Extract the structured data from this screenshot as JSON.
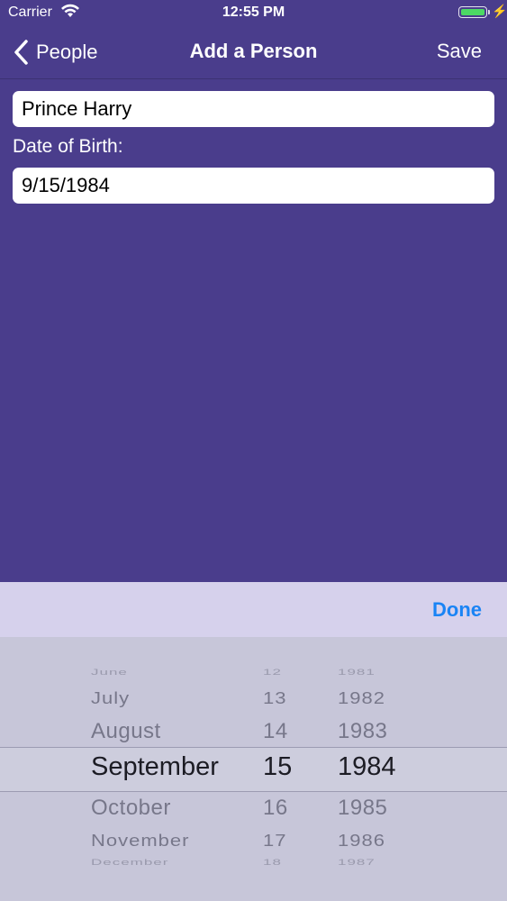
{
  "status_bar": {
    "carrier": "Carrier",
    "time": "12:55 PM"
  },
  "nav": {
    "back_label": "People",
    "title": "Add a Person",
    "save_label": "Save"
  },
  "form": {
    "name_value": "Prince Harry",
    "dob_label": "Date of Birth:",
    "dob_value": "9/15/1984"
  },
  "picker": {
    "done_label": "Done",
    "months": [
      "June",
      "July",
      "August",
      "September",
      "October",
      "November",
      "December"
    ],
    "days": [
      "12",
      "13",
      "14",
      "15",
      "16",
      "17",
      "18"
    ],
    "years": [
      "1981",
      "1982",
      "1983",
      "1984",
      "1985",
      "1986",
      "1987"
    ],
    "selected_index": 3
  },
  "colors": {
    "background": "#4a3d8c",
    "accent": "#1a84f5",
    "battery": "#4cd964"
  }
}
